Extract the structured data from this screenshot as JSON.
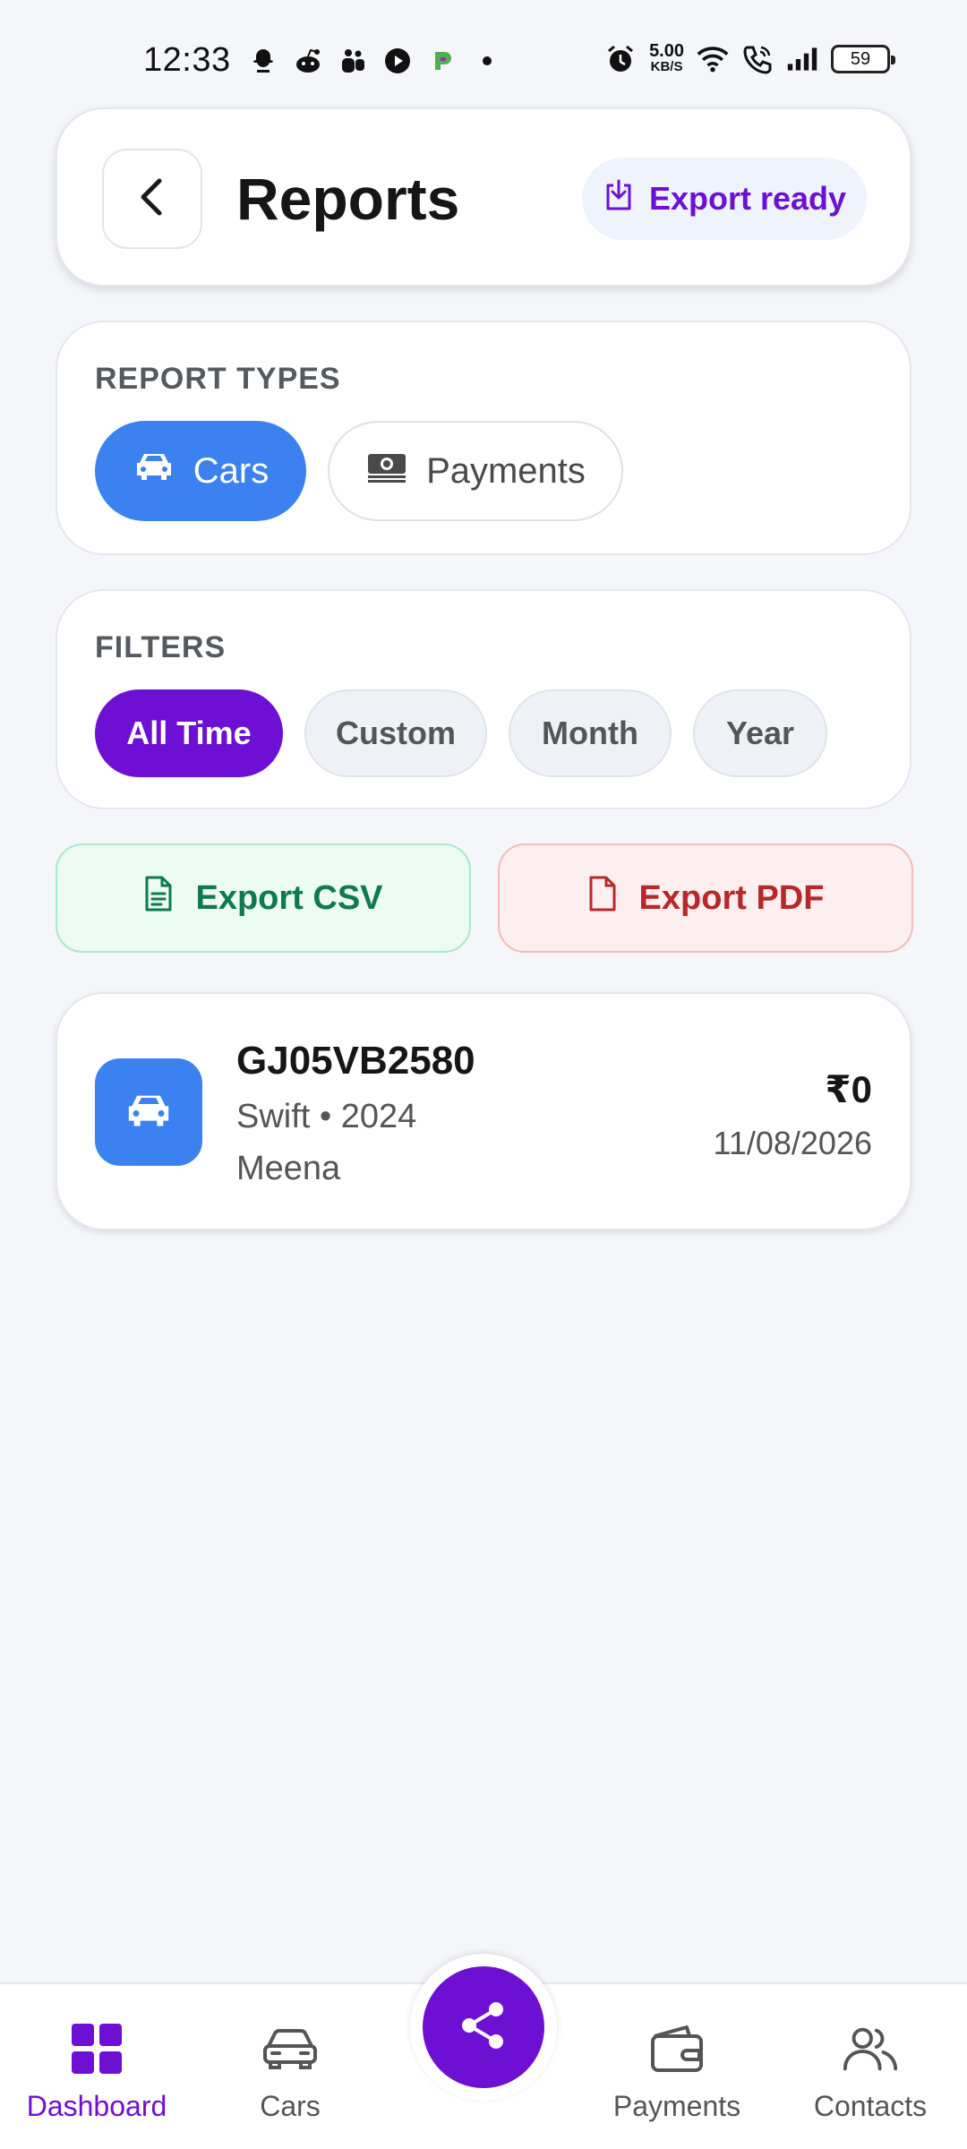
{
  "status_bar": {
    "time": "12:33",
    "net_speed_value": "5.00",
    "net_speed_unit": "KB/S",
    "battery": "59",
    "left_icons": [
      "snapchat-icon",
      "reddit-icon",
      "teams-icon",
      "youtube-icon",
      "app-icon",
      "dot-icon"
    ],
    "right_icons": [
      "alarm-icon",
      "wifi-icon",
      "call-icon",
      "signal-icon",
      "battery-icon"
    ]
  },
  "header": {
    "title": "Reports",
    "export_status": "Export ready",
    "back_icon": "chevron-left-icon",
    "export_icon": "download-icon"
  },
  "report_types": {
    "label": "REPORT TYPES",
    "options": [
      {
        "label": "Cars",
        "icon": "car-icon",
        "selected": true
      },
      {
        "label": "Payments",
        "icon": "money-icon",
        "selected": false
      }
    ]
  },
  "filters": {
    "label": "FILTERS",
    "options": [
      {
        "label": "All Time",
        "selected": true
      },
      {
        "label": "Custom",
        "selected": false
      },
      {
        "label": "Month",
        "selected": false
      },
      {
        "label": "Year",
        "selected": false
      }
    ]
  },
  "export_actions": {
    "csv_label": "Export CSV",
    "pdf_label": "Export PDF"
  },
  "records": [
    {
      "plate": "GJ05VB2580",
      "model": "Swift • 2024",
      "owner": "Meena",
      "amount": "₹0",
      "date": "11/08/2026"
    }
  ],
  "bottom_nav": {
    "items": [
      {
        "label": "Dashboard",
        "icon": "dashboard-icon",
        "active": true
      },
      {
        "label": "Cars",
        "icon": "car-icon",
        "active": false
      },
      {
        "label": "Payments",
        "icon": "wallet-icon",
        "active": false
      },
      {
        "label": "Contacts",
        "icon": "contacts-icon",
        "active": false
      }
    ],
    "fab_icon": "share-icon"
  },
  "colors": {
    "primary_purple": "#6d10d4",
    "accent_blue": "#3b82f0",
    "csv_green": "#0e7a4f",
    "pdf_red": "#b72828",
    "background": "#f4f6fa"
  }
}
